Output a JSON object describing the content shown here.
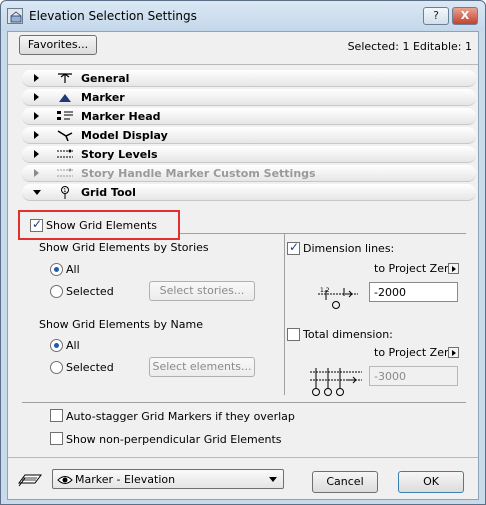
{
  "window": {
    "title": "Elevation Selection Settings",
    "help_label": "?",
    "close_label": "X"
  },
  "header": {
    "favorites_label": "Favorites...",
    "selection_info": "Selected: 1 Editable: 1"
  },
  "sections": [
    {
      "label": "General",
      "expanded": false,
      "enabled": true,
      "icon": "general-icon"
    },
    {
      "label": "Marker",
      "expanded": false,
      "enabled": true,
      "icon": "marker-icon"
    },
    {
      "label": "Marker Head",
      "expanded": false,
      "enabled": true,
      "icon": "marker-head-icon"
    },
    {
      "label": "Model Display",
      "expanded": false,
      "enabled": true,
      "icon": "model-display-icon"
    },
    {
      "label": "Story Levels",
      "expanded": false,
      "enabled": true,
      "icon": "story-levels-icon"
    },
    {
      "label": "Story Handle Marker Custom Settings",
      "expanded": false,
      "enabled": false,
      "icon": "story-handle-icon"
    },
    {
      "label": "Grid Tool",
      "expanded": true,
      "enabled": true,
      "icon": "grid-tool-icon"
    }
  ],
  "grid_tool": {
    "show_grid_elements": {
      "label": "Show Grid Elements",
      "checked": true
    },
    "by_stories": {
      "heading": "Show Grid Elements by Stories",
      "all_label": "All",
      "selected_label": "Selected",
      "choice": "All",
      "button_label": "Select stories..."
    },
    "by_name": {
      "heading": "Show Grid Elements by Name",
      "all_label": "All",
      "selected_label": "Selected",
      "choice": "All",
      "button_label": "Select elements..."
    },
    "dimension_lines": {
      "label": "Dimension lines:",
      "checked": true,
      "reference": "to Project Zero",
      "value": "-2000",
      "diagram_text": "1.2"
    },
    "total_dimension": {
      "label": "Total dimension:",
      "checked": false,
      "reference": "to Project Zero",
      "value": "-3000"
    },
    "auto_stagger": {
      "label": "Auto-stagger Grid Markers if they overlap",
      "checked": false
    },
    "non_perpendicular": {
      "label": "Show non-perpendicular Grid Elements",
      "checked": false
    }
  },
  "footer": {
    "favorite_select": "Marker - Elevation",
    "cancel_label": "Cancel",
    "ok_label": "OK"
  }
}
